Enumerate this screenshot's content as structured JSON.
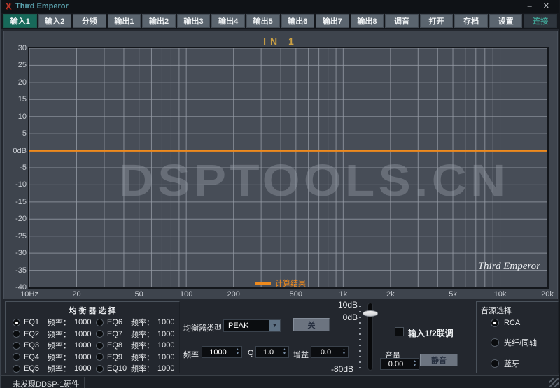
{
  "window": {
    "title": "Third Emperor",
    "minimize_label": "–",
    "close_label": "✕"
  },
  "tabs": [
    {
      "label": "输入1",
      "state": "active"
    },
    {
      "label": "输入2"
    },
    {
      "label": "分频"
    },
    {
      "label": "输出1"
    },
    {
      "label": "输出2"
    },
    {
      "label": "输出3"
    },
    {
      "label": "输出4"
    },
    {
      "label": "输出5"
    },
    {
      "label": "输出6"
    },
    {
      "label": "输出7"
    },
    {
      "label": "输出8"
    },
    {
      "label": "调音"
    },
    {
      "label": "打开"
    },
    {
      "label": "存档"
    },
    {
      "label": "设置"
    },
    {
      "label": "连接",
      "state": "disabled"
    }
  ],
  "chart": {
    "title": "IN 1",
    "watermark": "DSPTOOLS.CN",
    "brand": "Third Emperor",
    "legend": {
      "label": "计算结果",
      "color": "#ef8a1d"
    }
  },
  "chart_data": {
    "type": "line",
    "title": "IN 1",
    "x_scale": "log",
    "x_range": [
      10,
      20000
    ],
    "y_range": [
      -40,
      30
    ],
    "y_tick_step": 5,
    "grid": true,
    "legend_position": "bottom-center",
    "x_ticks": [
      {
        "v": 10,
        "label": "10Hz"
      },
      {
        "v": 20,
        "label": "20"
      },
      {
        "v": 50,
        "label": "50"
      },
      {
        "v": 100,
        "label": "100"
      },
      {
        "v": 200,
        "label": "200"
      },
      {
        "v": 500,
        "label": "500"
      },
      {
        "v": 1000,
        "label": "1k"
      },
      {
        "v": 2000,
        "label": "2k"
      },
      {
        "v": 5000,
        "label": "5k"
      },
      {
        "v": 10000,
        "label": "10k"
      },
      {
        "v": 20000,
        "label": "20k"
      }
    ],
    "y_ticks": [
      {
        "v": 30,
        "label": "30"
      },
      {
        "v": 25,
        "label": "25"
      },
      {
        "v": 20,
        "label": "20"
      },
      {
        "v": 15,
        "label": "15"
      },
      {
        "v": 10,
        "label": "10"
      },
      {
        "v": 5,
        "label": "5"
      },
      {
        "v": 0,
        "label": "0dB"
      },
      {
        "v": -5,
        "label": "-5"
      },
      {
        "v": -10,
        "label": "-10"
      },
      {
        "v": -15,
        "label": "-15"
      },
      {
        "v": -20,
        "label": "-20"
      },
      {
        "v": -25,
        "label": "-25"
      },
      {
        "v": -30,
        "label": "-30"
      },
      {
        "v": -35,
        "label": "-35"
      },
      {
        "v": -40,
        "label": "-40"
      }
    ],
    "series": [
      {
        "name": "计算结果",
        "color": "#ef8a1d",
        "points": [
          [
            10,
            0
          ],
          [
            20000,
            0
          ]
        ]
      }
    ]
  },
  "eq_panel": {
    "title": "均 衡 器 选 择",
    "freq_label": "频率：",
    "items": [
      {
        "name": "EQ1",
        "freq": "1000",
        "selected": true
      },
      {
        "name": "EQ2",
        "freq": "1000",
        "selected": false
      },
      {
        "name": "EQ3",
        "freq": "1000",
        "selected": false
      },
      {
        "name": "EQ4",
        "freq": "1000",
        "selected": false
      },
      {
        "name": "EQ5",
        "freq": "1000",
        "selected": false
      },
      {
        "name": "EQ6",
        "freq": "1000",
        "selected": false
      },
      {
        "name": "EQ7",
        "freq": "1000",
        "selected": false
      },
      {
        "name": "EQ8",
        "freq": "1000",
        "selected": false
      },
      {
        "name": "EQ9",
        "freq": "1000",
        "selected": false
      },
      {
        "name": "EQ10",
        "freq": "1000",
        "selected": false
      }
    ]
  },
  "filter_panel": {
    "type_label": "均衡器类型",
    "type_value": "PEAK",
    "dropdown_arrow": "▼",
    "off_button": "关",
    "freq_label": "频率",
    "freq_value": "1000",
    "q_label": "Q",
    "q_value": "1.0",
    "gain_label": "增益",
    "gain_value": "0.0"
  },
  "volume_panel": {
    "top_label": "10dB",
    "zero_label": "0dB",
    "bottom_label": "-80dB",
    "link_checkbox_label": "输入1/2联调",
    "link_checked": false,
    "volume_label": "音量",
    "volume_value": "0.00",
    "mute_button": "静音"
  },
  "source_panel": {
    "title": "音源选择",
    "options": [
      {
        "label": "RCA",
        "selected": true
      },
      {
        "label": "光纤/同轴",
        "selected": false
      },
      {
        "label": "蓝牙",
        "selected": false
      }
    ]
  },
  "status_bar": {
    "message": "未发现DDSP-1硬件"
  },
  "colors": {
    "accent_orange": "#ef8a1d",
    "tab_active": "#17695a",
    "plot_bg": "#474d57",
    "grid": "#969ca6"
  }
}
